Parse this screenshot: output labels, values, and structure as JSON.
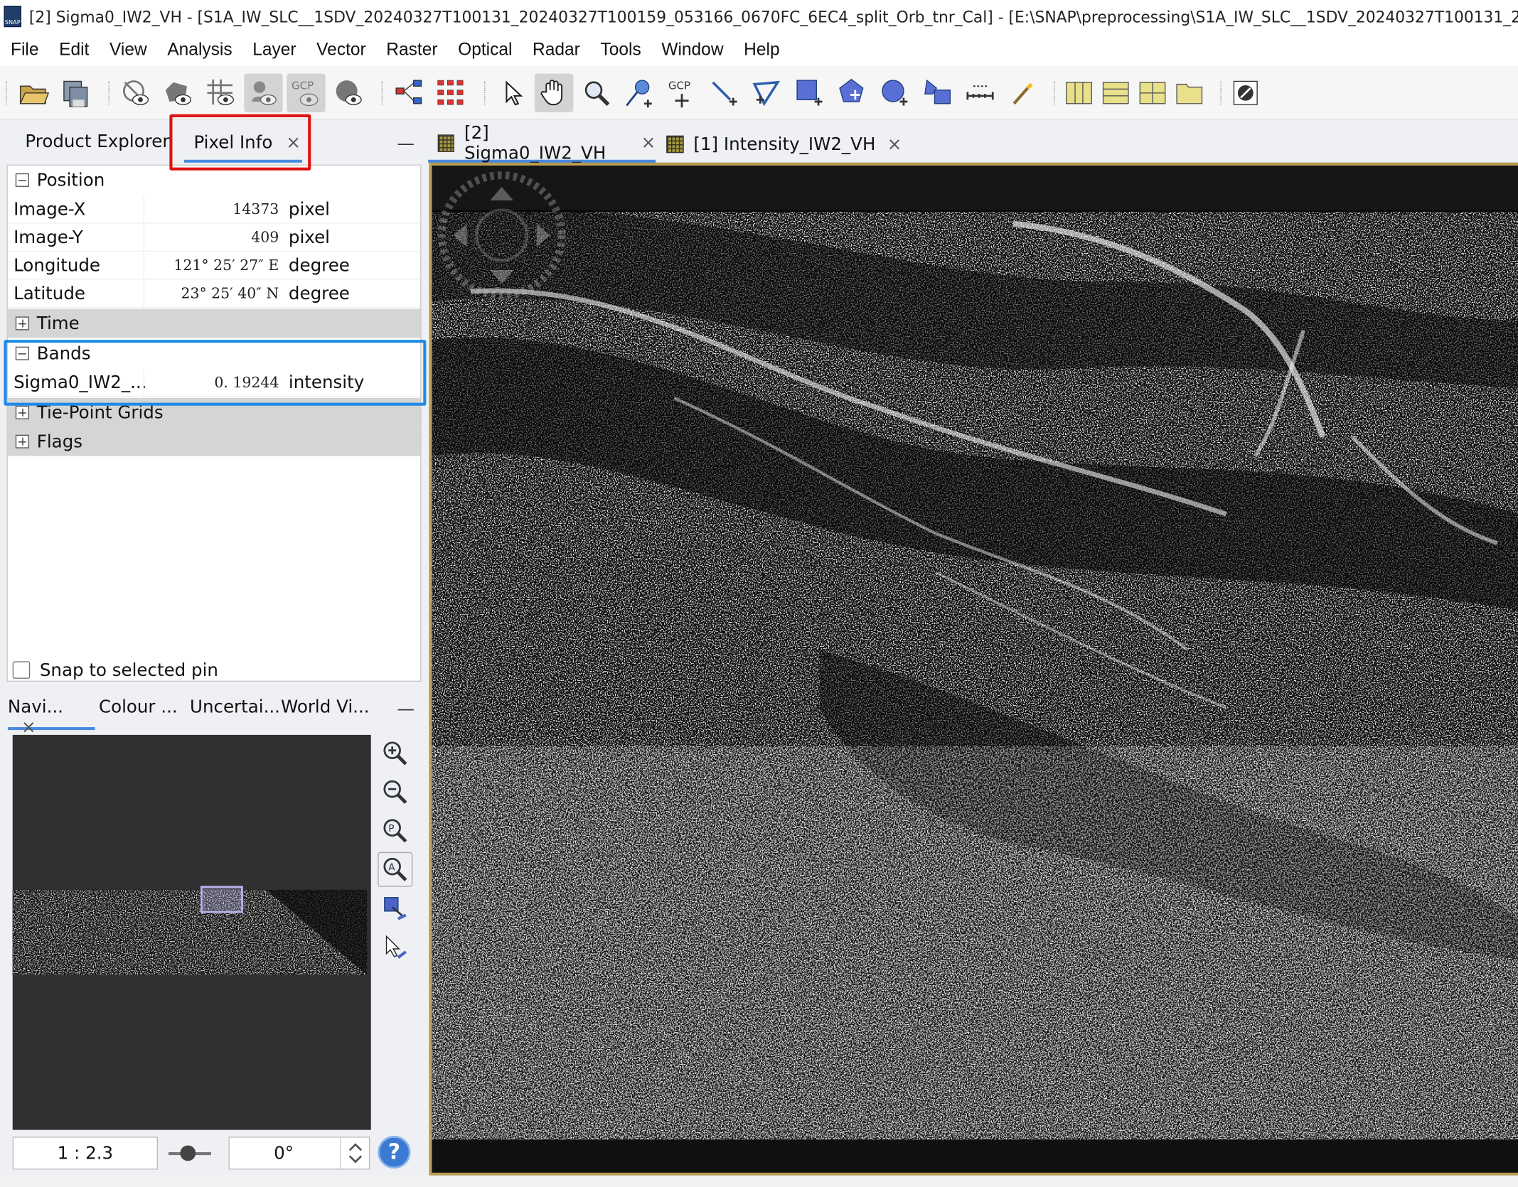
{
  "window": {
    "title": "[2] Sigma0_IW2_VH - [S1A_IW_SLC__1SDV_20240327T100131_20240327T100159_053166_0670FC_6EC4_split_Orb_tnr_Cal] - [E:\\SNAP\\preprocessing\\S1A_IW_SLC__1SDV_20240327T100131_20240327T",
    "app_icon_text": "SNAP"
  },
  "menu": [
    "File",
    "Edit",
    "View",
    "Analysis",
    "Layer",
    "Vector",
    "Raster",
    "Optical",
    "Radar",
    "Tools",
    "Window",
    "Help"
  ],
  "toolbar": {
    "icons": [
      "open-product-icon",
      "save-product-icon",
      "show-hide-layers-icon",
      "overlay-icon",
      "graticule-icon",
      "pin-overlay-icon",
      "gcp-overlay-icon",
      "world-map-overlay-icon",
      "graph-builder-icon",
      "batch-processing-icon",
      "select-tool-icon",
      "pan-tool-icon",
      "zoom-tool-icon",
      "pin-placing-tool-icon",
      "gcp-placing-tool-icon",
      "line-drawing-tool-icon",
      "polyline-drawing-tool-icon",
      "rectangle-drawing-tool-icon",
      "polygon-drawing-tool-icon",
      "ellipse-drawing-tool-icon",
      "insert-vector-icon",
      "range-finder-icon",
      "magic-wand-icon",
      "tile-evenly-icon",
      "tile-horizontally-icon",
      "tile-vertically-icon",
      "tile-single-icon",
      "sync-views-icon"
    ],
    "gcp_label": "GCP"
  },
  "left_panel": {
    "tabs": {
      "product_explorer": "Product Explorer",
      "pixel_info": "Pixel Info",
      "close": "×",
      "minimize": "—"
    },
    "position": {
      "header": "Position",
      "rows": [
        {
          "key": "Image-X",
          "value": "14373",
          "unit": "pixel"
        },
        {
          "key": "Image-Y",
          "value": "409",
          "unit": "pixel"
        },
        {
          "key": "Longitude",
          "value": "121° 25′ 27″ E",
          "unit": "degree"
        },
        {
          "key": "Latitude",
          "value": "23° 25′ 40″ N",
          "unit": "degree"
        }
      ]
    },
    "time": {
      "header": "Time"
    },
    "bands": {
      "header": "Bands",
      "rows": [
        {
          "key": "Sigma0_IW2_...",
          "value": "0. 19244",
          "unit": "intensity"
        }
      ]
    },
    "tie_point": {
      "header": "Tie-Point Grids"
    },
    "flags": {
      "header": "Flags"
    },
    "snap_label": "Snap to selected pin"
  },
  "nav_panel": {
    "tabs": [
      "Navi...",
      "Colour ...",
      "Uncertai...",
      "World Vi..."
    ],
    "close": "×",
    "minimize": "—",
    "scale": "1 : 2.3",
    "rotation": "0°",
    "help": "?",
    "tool_icons": [
      "zoom-in-icon",
      "zoom-out-icon",
      "zoom-pixel-icon",
      "zoom-all-icon",
      "sync-views-icon",
      "sync-cursor-icon"
    ]
  },
  "doc_tabs": [
    {
      "label": "[2] Sigma0_IW2_VH",
      "active": true
    },
    {
      "label": "[1] Intensity_IW2_VH",
      "active": false
    }
  ],
  "colors": {
    "highlight_red": "#e01010",
    "highlight_blue": "#1e8be8",
    "tab_accent": "#4a8ae0",
    "view_border": "#b99c52"
  }
}
